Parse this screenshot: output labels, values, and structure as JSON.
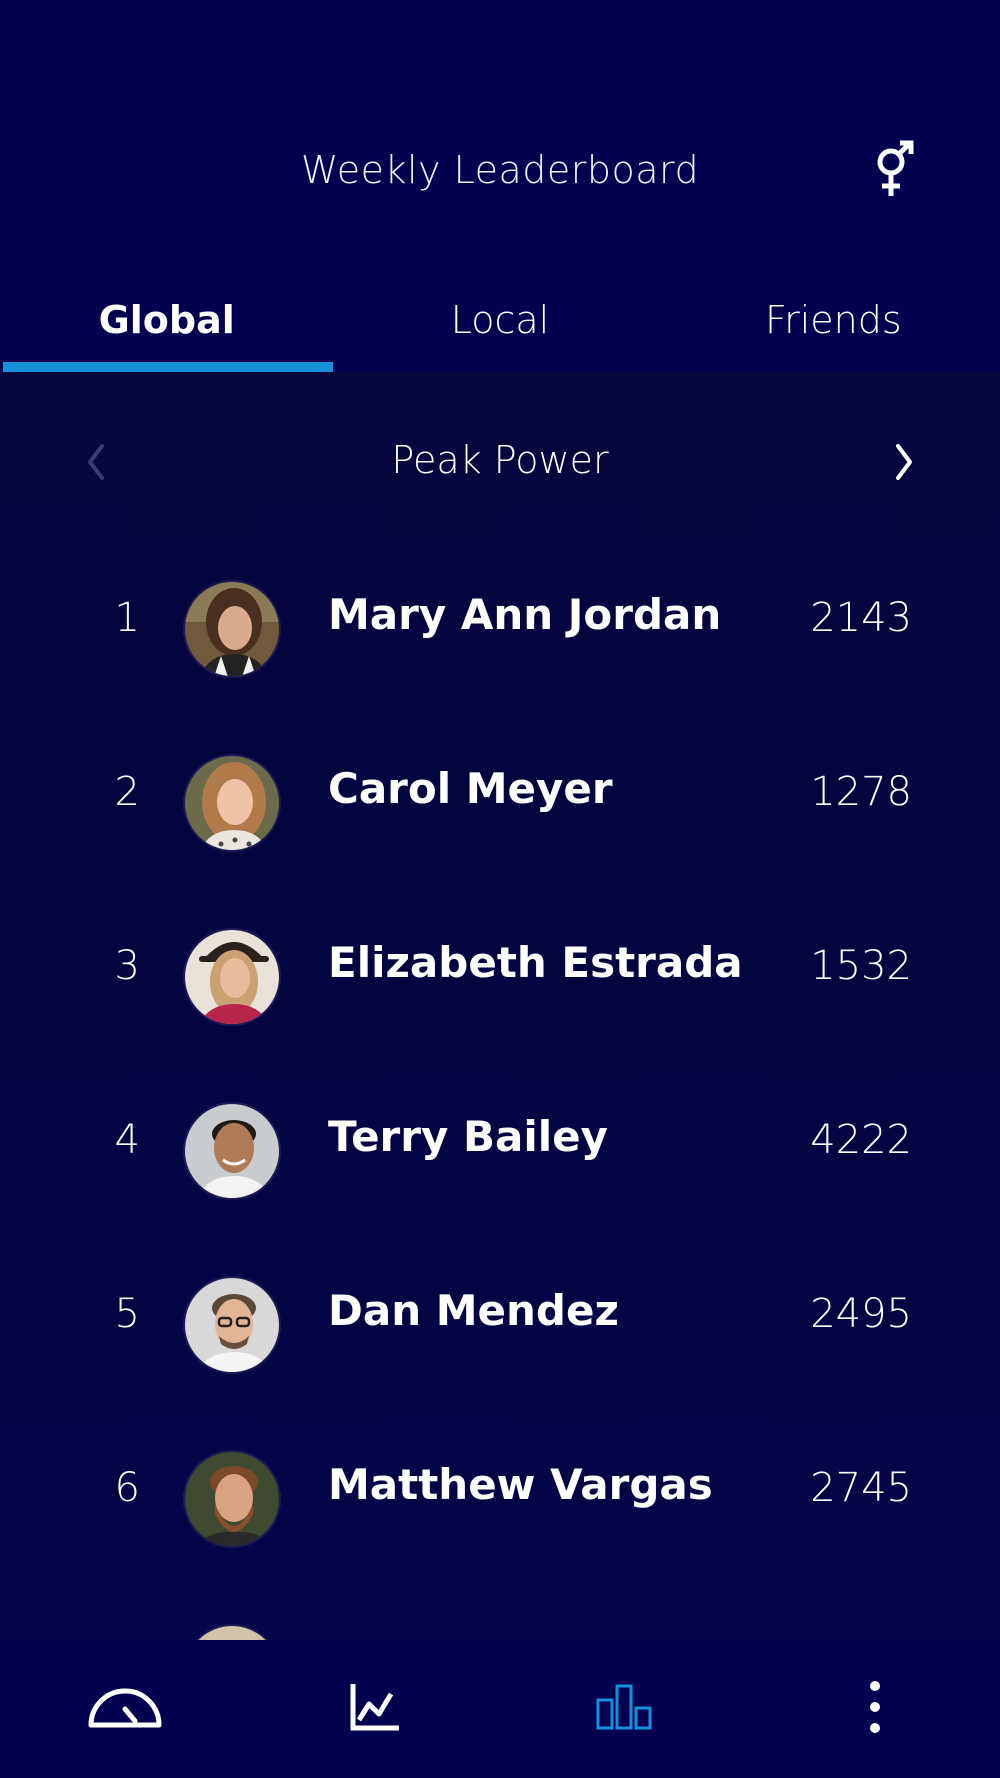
{
  "header": {
    "title": "Weekly Leaderboard",
    "icon": "gender-icon"
  },
  "tabs": [
    {
      "label": "Global",
      "active": true
    },
    {
      "label": "Local",
      "active": false
    },
    {
      "label": "Friends",
      "active": false
    }
  ],
  "metric": {
    "title": "Peak Power",
    "prev_icon": "chevron-left-icon",
    "next_icon": "chevron-right-icon"
  },
  "leaderboard": [
    {
      "rank": "1",
      "name": "Mary Ann Jordan",
      "score": "2143"
    },
    {
      "rank": "2",
      "name": "Carol Meyer",
      "score": "1278"
    },
    {
      "rank": "3",
      "name": "Elizabeth Estrada",
      "score": "1532"
    },
    {
      "rank": "4",
      "name": "Terry Bailey",
      "score": "4222"
    },
    {
      "rank": "5",
      "name": "Dan Mendez",
      "score": "2495"
    },
    {
      "rank": "6",
      "name": "Matthew Vargas",
      "score": "2745"
    }
  ],
  "bottom_nav": [
    {
      "icon": "speedometer-icon",
      "active": false
    },
    {
      "icon": "line-chart-icon",
      "active": false
    },
    {
      "icon": "bar-chart-icon",
      "active": true
    },
    {
      "icon": "more-vertical-icon",
      "active": false
    }
  ],
  "colors": {
    "background": "#03004f",
    "accent": "#1592d8",
    "text": "#ffffff"
  }
}
